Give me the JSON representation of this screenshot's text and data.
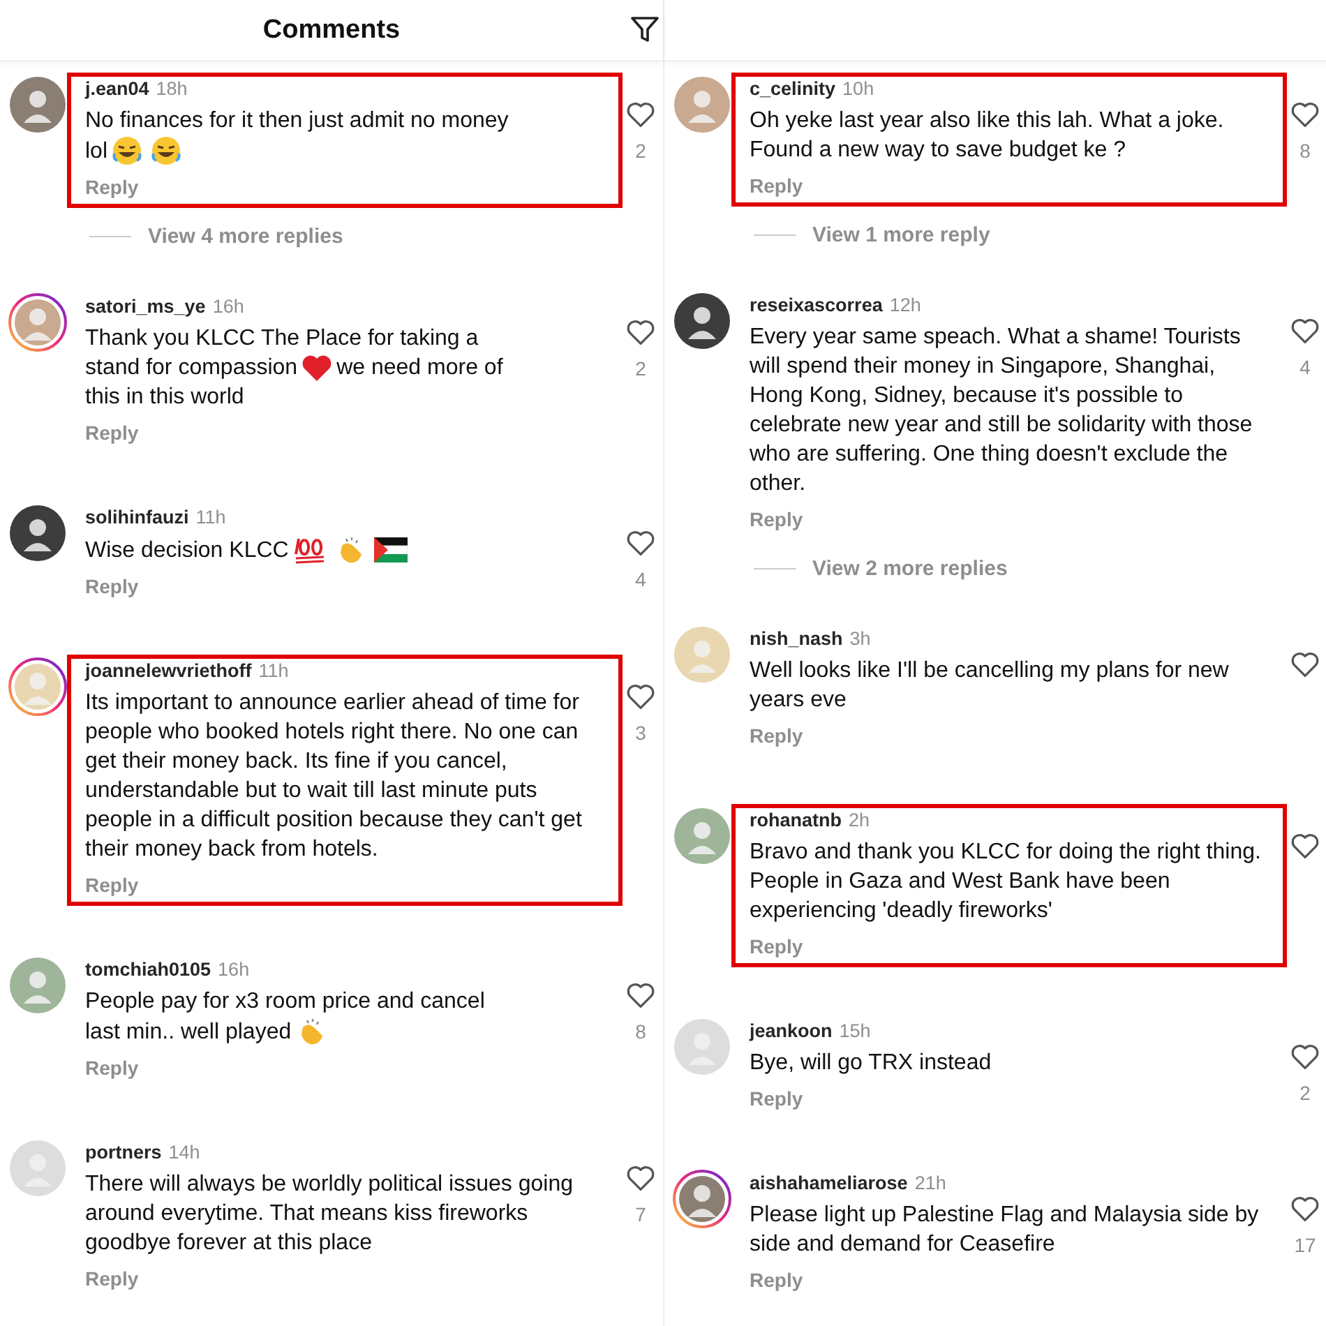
{
  "columns": [
    {
      "title": "Comments",
      "comments": [
        {
          "user": "j.ean04",
          "time": "18h",
          "ring": false,
          "highlighted": true,
          "likes": "2",
          "reply": "Reply",
          "more": "View 4 more replies",
          "lines": [
            [
              {
                "kind": "text",
                "text": "No finances for it then just admit no money"
              }
            ],
            [
              {
                "kind": "text",
                "text": "lol"
              },
              {
                "kind": "laughing"
              },
              {
                "kind": "laughing"
              }
            ]
          ]
        },
        {
          "user": "satori_ms_ye",
          "time": "16h",
          "ring": true,
          "highlighted": false,
          "likes": "2",
          "reply": "Reply",
          "lines": [
            [
              {
                "kind": "text",
                "text": "Thank you KLCC The Place for taking a"
              }
            ],
            [
              {
                "kind": "text",
                "text": "stand for compassion"
              },
              {
                "kind": "heart"
              },
              {
                "kind": "text",
                "text": "we need more of"
              }
            ],
            [
              {
                "kind": "text",
                "text": "this in this world"
              }
            ]
          ]
        },
        {
          "user": "solihinfauzi",
          "time": "11h",
          "ring": false,
          "highlighted": false,
          "likes": "4",
          "reply": "Reply",
          "lines": [
            [
              {
                "kind": "text",
                "text": "Wise decision KLCC"
              },
              {
                "kind": "hundred"
              },
              {
                "kind": "clap"
              },
              {
                "kind": "flag"
              }
            ]
          ]
        },
        {
          "user": "joannelewvriethoff",
          "time": "11h",
          "ring": true,
          "highlighted": true,
          "likes": "3",
          "reply": "Reply",
          "text": "Its important to announce earlier ahead of time for people who booked hotels right there. No one can get their money back.  Its fine if you cancel, understandable  but to wait till last minute puts people in a difficult position because they can't get their money back from hotels."
        },
        {
          "user": "tomchiah0105",
          "time": "16h",
          "ring": false,
          "highlighted": false,
          "likes": "8",
          "reply": "Reply",
          "lines": [
            [
              {
                "kind": "text",
                "text": "People pay for x3 room price and cancel"
              }
            ],
            [
              {
                "kind": "text",
                "text": "last min.. well played"
              },
              {
                "kind": "clap"
              }
            ]
          ]
        },
        {
          "user": "portners",
          "time": "14h",
          "ring": false,
          "highlighted": false,
          "likes": "7",
          "reply": "Reply",
          "text": "There will always be worldly political issues going around everytime. That means kiss fireworks goodbye forever at this place"
        }
      ]
    },
    {
      "comments": [
        {
          "user": "c_celinity",
          "time": "10h",
          "ring": false,
          "highlighted": true,
          "likes": "8",
          "reply": "Reply",
          "more": "View 1 more reply",
          "text": "Oh yeke last year also like this lah. What a joke. Found a new way to save budget ke ?"
        },
        {
          "user": "reseixascorrea",
          "time": "12h",
          "ring": false,
          "highlighted": false,
          "likes": "4",
          "reply": "Reply",
          "more": "View 2 more replies",
          "text": "Every year same speach. What a shame! Tourists will spend their money in Singapore, Shanghai, Hong Kong, Sidney, because it's possible to celebrate new year and still be solidarity with those who are suffering. One thing doesn't exclude the other."
        },
        {
          "user": "nish_nash",
          "time": "3h",
          "ring": false,
          "highlighted": false,
          "reply": "Reply",
          "text": "Well looks like I'll be cancelling my plans for new years eve"
        },
        {
          "user": "rohanatnb",
          "time": "2h",
          "ring": false,
          "highlighted": true,
          "reply": "Reply",
          "text": "Bravo and thank you KLCC for doing the right thing. People in Gaza and West Bank have been experiencing 'deadly fireworks'"
        },
        {
          "user": "jeankoon",
          "time": "15h",
          "ring": false,
          "highlighted": false,
          "likes": "2",
          "reply": "Reply",
          "text": "Bye, will go TRX instead"
        },
        {
          "user": "aishahameliarose",
          "time": "21h",
          "ring": true,
          "highlighted": false,
          "likes": "17",
          "reply": "Reply",
          "text": "Please light up Palestine Flag and Malaysia side by side and demand for Ceasefire"
        }
      ]
    }
  ]
}
